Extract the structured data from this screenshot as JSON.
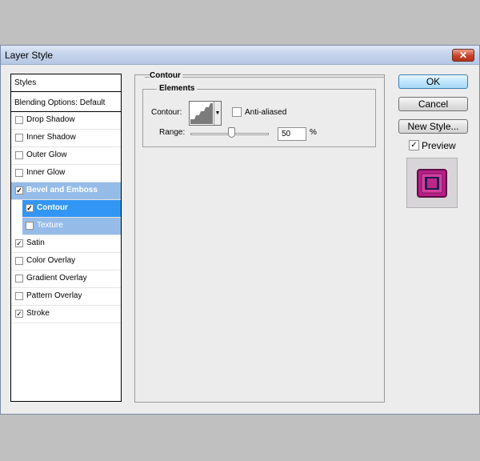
{
  "window": {
    "title": "Layer Style",
    "close_glyph": "✕"
  },
  "styles_panel": {
    "header": "Styles",
    "blending": "Blending Options: Default",
    "items": [
      {
        "label": "Drop Shadow",
        "checked": false
      },
      {
        "label": "Inner Shadow",
        "checked": false
      },
      {
        "label": "Outer Glow",
        "checked": false
      },
      {
        "label": "Inner Glow",
        "checked": false
      },
      {
        "label": "Bevel and Emboss",
        "checked": true
      },
      {
        "label": "Contour",
        "checked": true
      },
      {
        "label": "Texture",
        "checked": false
      },
      {
        "label": "Satin",
        "checked": true
      },
      {
        "label": "Color Overlay",
        "checked": false
      },
      {
        "label": "Gradient Overlay",
        "checked": false
      },
      {
        "label": "Pattern Overlay",
        "checked": false
      },
      {
        "label": "Stroke",
        "checked": true
      }
    ]
  },
  "contour_panel": {
    "section_title": "Contour",
    "group_title": "Elements",
    "contour_label": "Contour:",
    "anti_aliased_label": "Anti-aliased",
    "anti_aliased_checked": false,
    "range_label": "Range:",
    "range_value": "50",
    "range_unit": "%"
  },
  "buttons": {
    "ok": "OK",
    "cancel": "Cancel",
    "new_style": "New Style..."
  },
  "preview": {
    "label": "Preview",
    "checked": true
  },
  "colors": {
    "selection_dark": "#3296f5",
    "selection_light": "#95bce8",
    "preview_magenta": "#c0268a"
  },
  "check_glyph": "✓"
}
